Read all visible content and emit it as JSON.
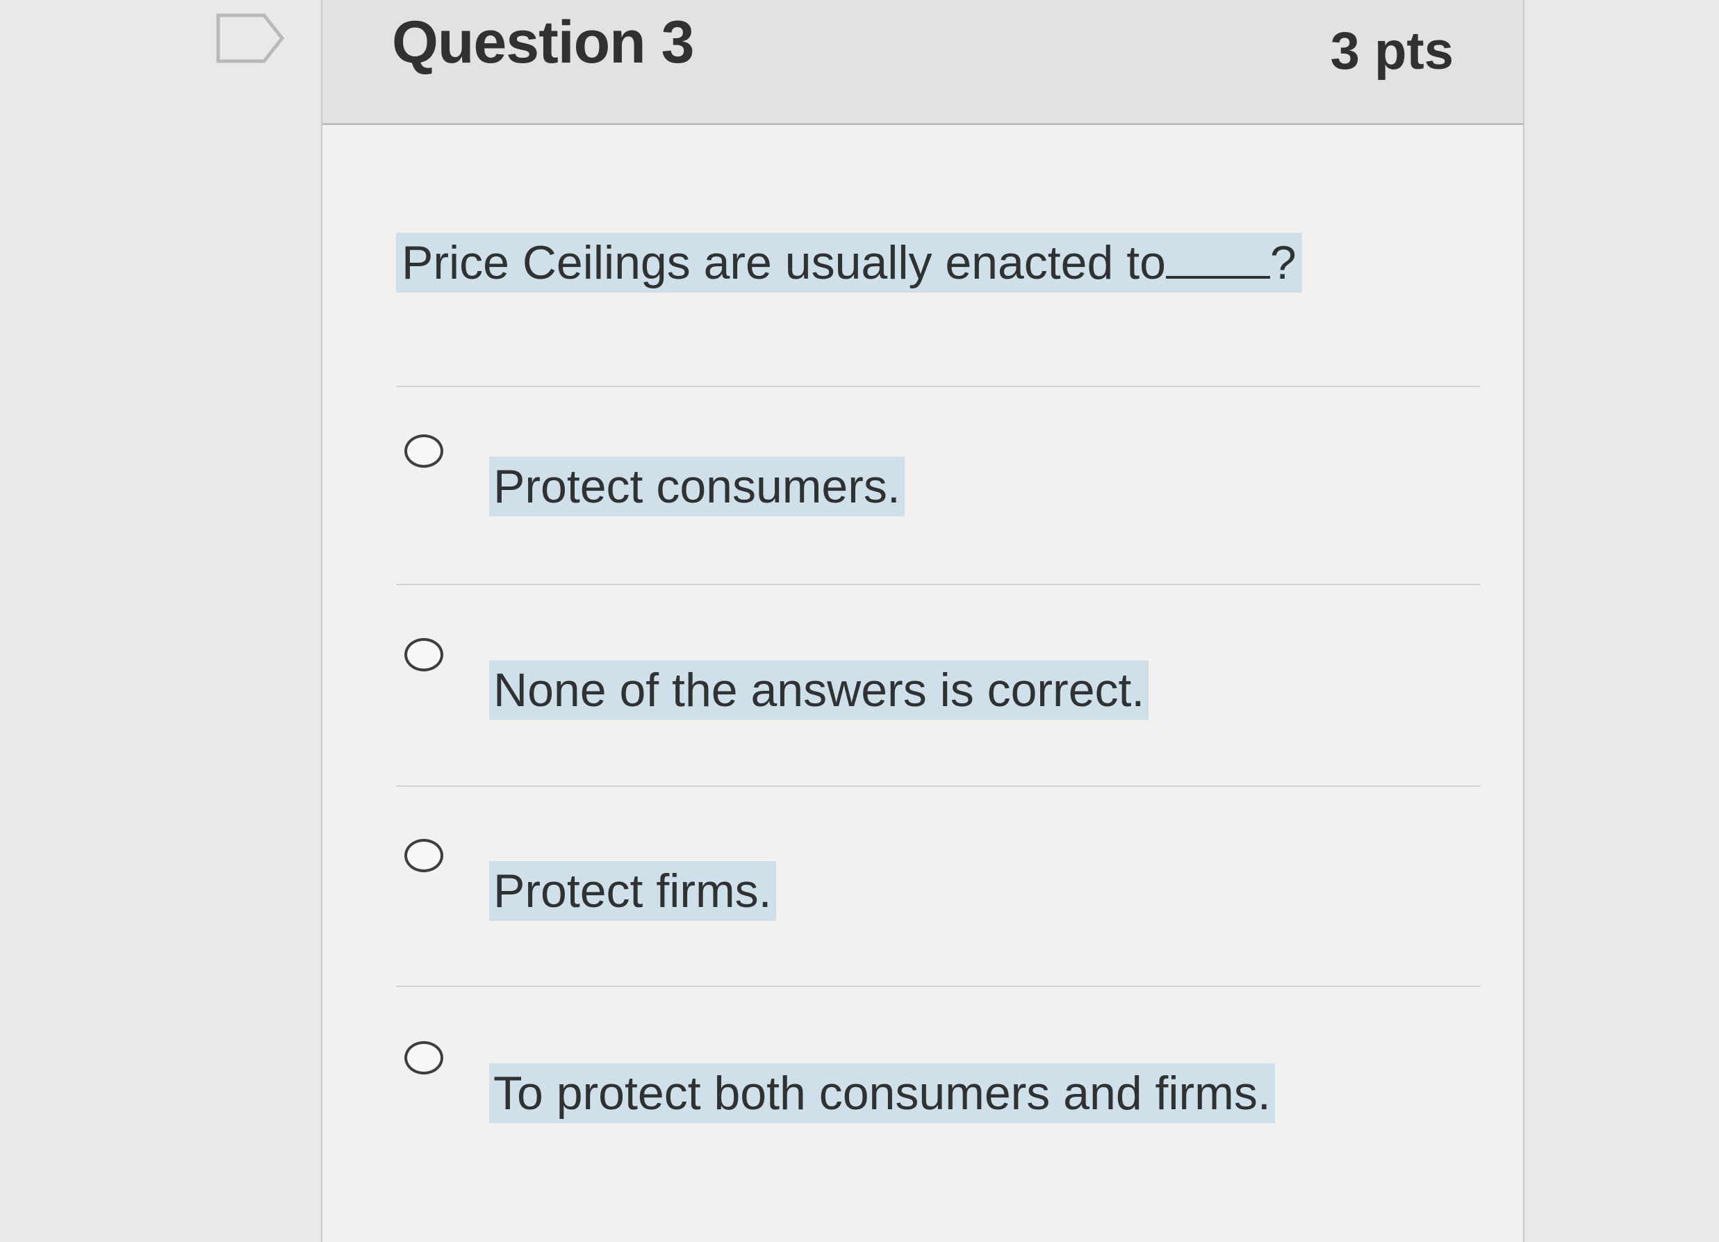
{
  "question": {
    "title": "Question 3",
    "points": "3 pts",
    "text": "Price Ceilings are usually enacted to",
    "text_end": "?",
    "flag_icon": "flag-outline-icon"
  },
  "answers": [
    {
      "label": "Protect consumers.",
      "selected": false
    },
    {
      "label": "None of the answers is correct.",
      "selected": false
    },
    {
      "label": "Protect firms.",
      "selected": false
    },
    {
      "label": "To protect both consumers and firms.",
      "selected": false
    }
  ],
  "colors": {
    "highlight": "#cfe0ea",
    "text": "#2f3133",
    "header_bg": "#e2e2e0"
  }
}
